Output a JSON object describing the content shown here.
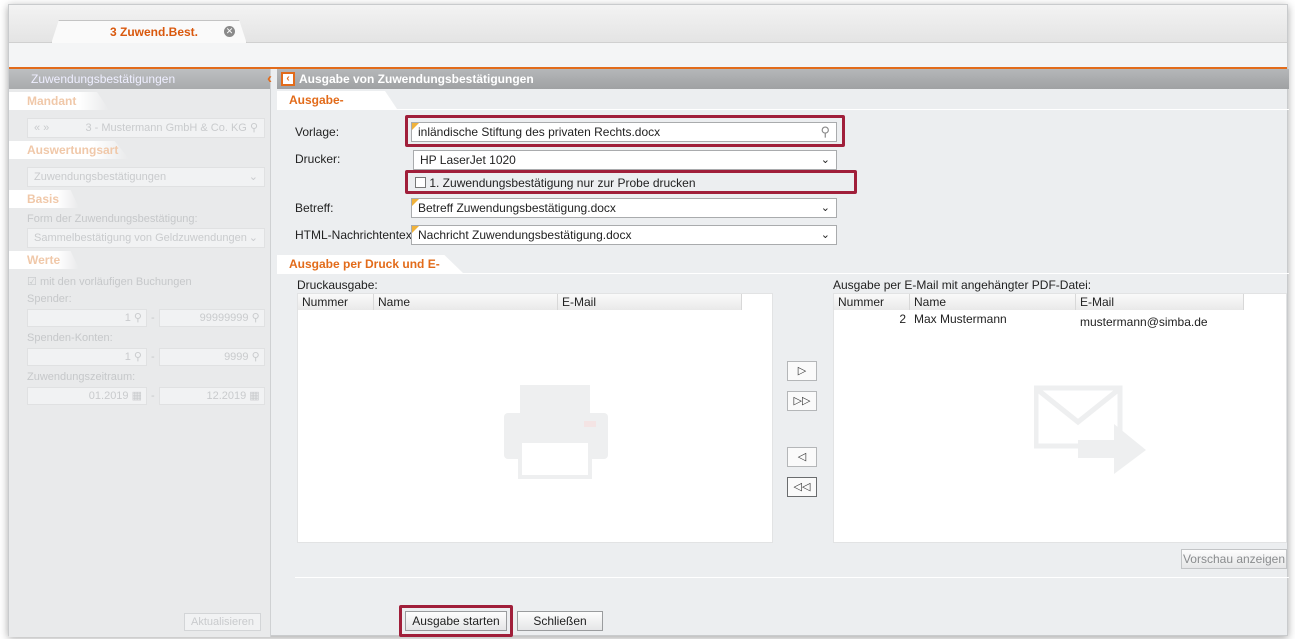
{
  "tab": {
    "label": "3 Zuwend.Best."
  },
  "left": {
    "title": "Zuwendungsbestätigungen",
    "mandant_heading": "Mandant",
    "mandant_value": "3 - Mustermann GmbH & Co. KG",
    "auswertungsart_heading": "Auswertungsart",
    "auswertungsart_value": "Zuwendungsbestätigungen",
    "basis_heading": "Basis",
    "form_label": "Form der Zuwendungsbestätigung:",
    "form_value": "Sammelbestätigung von Geldzuwendungen",
    "werte_heading": "Werte",
    "checkbox_label": "mit den vorläufigen Buchungen",
    "spender_label": "Spender:",
    "spender_from": "1",
    "spender_to": "99999999",
    "konten_label": "Spenden-Konten:",
    "konten_from": "1",
    "konten_to": "9999",
    "zeitraum_label": "Zuwendungszeitraum:",
    "zeitraum_from": "01.2019",
    "zeitraum_to": "12.2019",
    "dash": "-",
    "refresh_button": "Aktualisieren"
  },
  "right": {
    "title": "Ausgabe von Zuwendungsbestätigungen",
    "params_heading": "Ausgabe-Parameter",
    "vorlage_label": "Vorlage:",
    "vorlage_value": "inländische Stiftung des privaten Rechts.docx",
    "drucker_label": "Drucker:",
    "drucker_value": "HP LaserJet 1020",
    "probe_label": "1. Zuwendungsbestätigung nur zur Probe drucken",
    "betreff_label": "Betreff:",
    "betreff_value": "Betreff Zuwendungsbestätigung.docx",
    "html_label": "HTML-Nachrichtentext:",
    "html_value": "Nachricht Zuwendungsbestätigung.docx",
    "output_heading": "Ausgabe per Druck und E-Mail",
    "print_label": "Druckausgabe:",
    "email_label": "Ausgabe per E-Mail mit angehängter PDF-Datei:",
    "columns": [
      "Nummer",
      "Name",
      "E-Mail"
    ],
    "email_rows": [
      {
        "nummer": "2",
        "name": "Max Mustermann",
        "email": "mustermann@simba.de"
      }
    ],
    "move_right": "▷",
    "move_all_right": "▷▷",
    "move_left": "◁",
    "move_all_left": "◁◁",
    "preview_button": "Vorschau anzeigen",
    "start_button": "Ausgabe starten",
    "close_button": "Schließen"
  },
  "colors": {
    "accent": "#e26b1a",
    "highlight": "#a01f3a"
  }
}
